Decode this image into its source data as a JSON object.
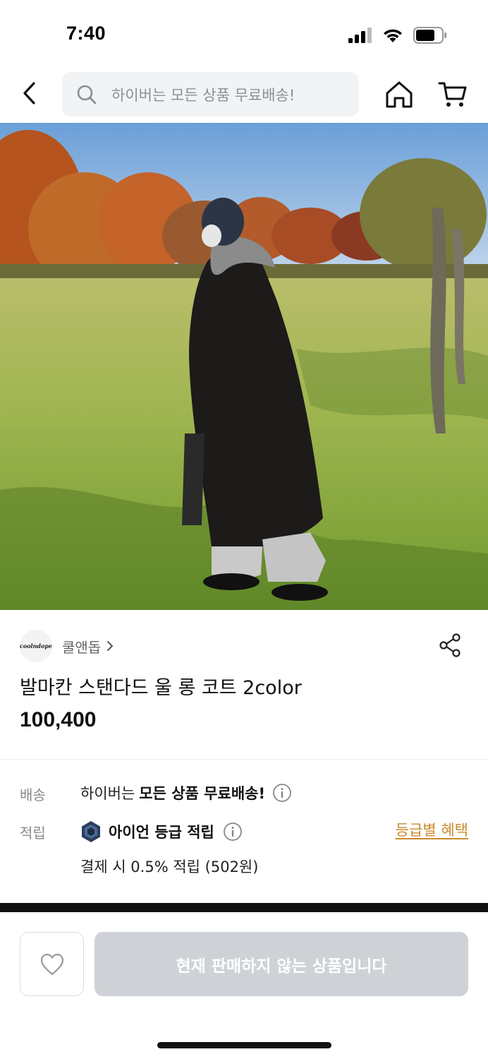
{
  "status_bar": {
    "time": "7:40"
  },
  "header": {
    "search_placeholder": "하이버는 모든 상품 무료배송!"
  },
  "product": {
    "brand_logo_text": "coolndope",
    "brand_name": "쿨앤돕",
    "title": "발마칸 스탠다드 울 롱 코트 2color",
    "price": "100,400"
  },
  "shipping": {
    "label": "배송",
    "prefix": "하이버는 ",
    "highlight": "모든 상품 무료배송!"
  },
  "points": {
    "label": "적립",
    "grade_text": "아이언 등급 적립",
    "grade_link": "등급별 혜택",
    "detail": "결제 시 0.5% 적립 (502원)"
  },
  "bottom": {
    "buy_label": "현재 판매하지 않는 상품입니다"
  },
  "colors": {
    "accent_link": "#c98b2e",
    "disabled_button": "#ced2d6"
  }
}
